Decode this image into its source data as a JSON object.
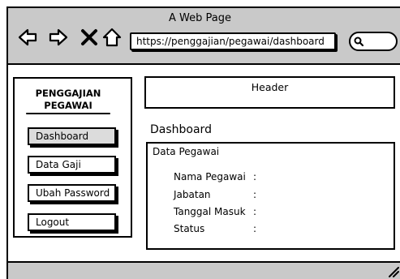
{
  "window": {
    "title": "A Web Page"
  },
  "browser": {
    "url": "https://penggajian/pegawai/dashboard",
    "icons": [
      "back-arrow-icon",
      "forward-arrow-icon",
      "close-icon",
      "home-icon",
      "search-icon"
    ]
  },
  "sidebar": {
    "brand_line1": "PENGGAJIAN",
    "brand_line2": "PEGAWAI",
    "items": [
      {
        "label": "Dashboard",
        "active": true
      },
      {
        "label": "Data Gaji",
        "active": false
      },
      {
        "label": "Ubah Password",
        "active": false
      },
      {
        "label": "Logout",
        "active": false
      }
    ]
  },
  "header": {
    "label": "Header"
  },
  "main": {
    "title": "Dashboard",
    "card": {
      "title": "Data Pegawai",
      "fields": [
        {
          "label": "Nama Pegawai",
          "sep": ":"
        },
        {
          "label": "Jabatan",
          "sep": ":"
        },
        {
          "label": "Tanggal Masuk",
          "sep": ":"
        },
        {
          "label": "Status",
          "sep": ":"
        }
      ]
    }
  },
  "colors": {
    "chrome": "#c9c9c9",
    "active_nav": "#dcdcdc"
  }
}
